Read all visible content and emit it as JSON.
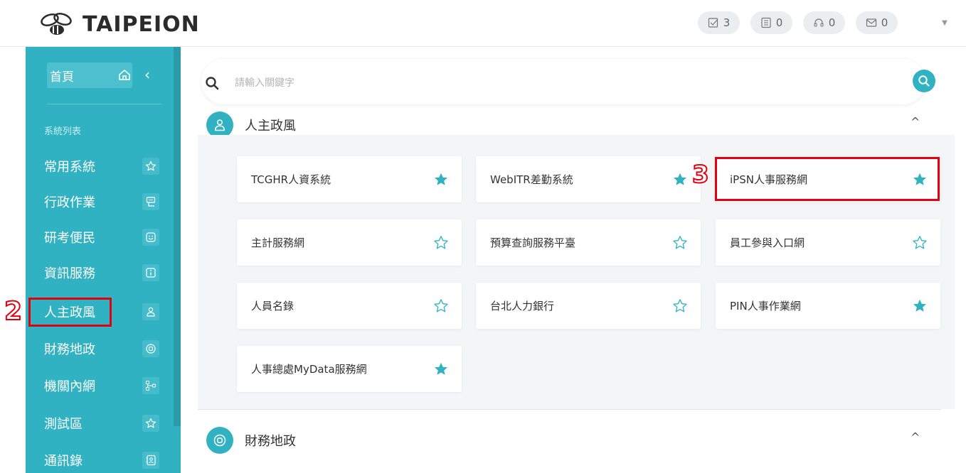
{
  "header": {
    "logo_text": "TAIPEION",
    "badges": [
      {
        "icon": "checkbox-icon",
        "count": "3"
      },
      {
        "icon": "list-icon",
        "count": "0"
      },
      {
        "icon": "headset-icon",
        "count": "0"
      },
      {
        "icon": "mail-icon",
        "count": "0"
      }
    ],
    "user_menu_icon": "caret-down-icon"
  },
  "sidebar": {
    "home_label": "首頁",
    "section_label": "系統列表",
    "items": [
      {
        "label": "常用系統",
        "icon": "star-outline-icon"
      },
      {
        "label": "行政作業",
        "icon": "form-icon"
      },
      {
        "label": "研考便民",
        "icon": "smile-icon"
      },
      {
        "label": "資訊服務",
        "icon": "info-icon"
      },
      {
        "label": "人主政風",
        "icon": "person-icon"
      },
      {
        "label": "財務地政",
        "icon": "coin-icon"
      },
      {
        "label": "機關內網",
        "icon": "network-icon"
      },
      {
        "label": "測試區",
        "icon": "star-outline-icon"
      },
      {
        "label": "通訊錄",
        "icon": "contacts-icon"
      }
    ]
  },
  "search": {
    "placeholder": "請輸入關鍵字"
  },
  "categories": [
    {
      "title": "人主政風",
      "toggle": "^",
      "cards": [
        {
          "label": "TCGHR人資系統",
          "favorite": true
        },
        {
          "label": "WebITR差勤系統",
          "favorite": true
        },
        {
          "label": "iPSN人事服務網",
          "favorite": true
        },
        {
          "label": "主計服務網",
          "favorite": false
        },
        {
          "label": "預算查詢服務平臺",
          "favorite": false
        },
        {
          "label": "員工參與入口網",
          "favorite": false
        },
        {
          "label": "人員名錄",
          "favorite": false
        },
        {
          "label": "台北人力銀行",
          "favorite": false
        },
        {
          "label": "PIN人事作業網",
          "favorite": true
        },
        {
          "label": "人事總處MyData服務網",
          "favorite": true
        }
      ]
    },
    {
      "title": "財務地政",
      "toggle": "^"
    }
  ],
  "annotations": {
    "step2": "2",
    "step3": "3"
  },
  "colors": {
    "accent": "#30b2c2",
    "highlight": "#e3000f"
  }
}
